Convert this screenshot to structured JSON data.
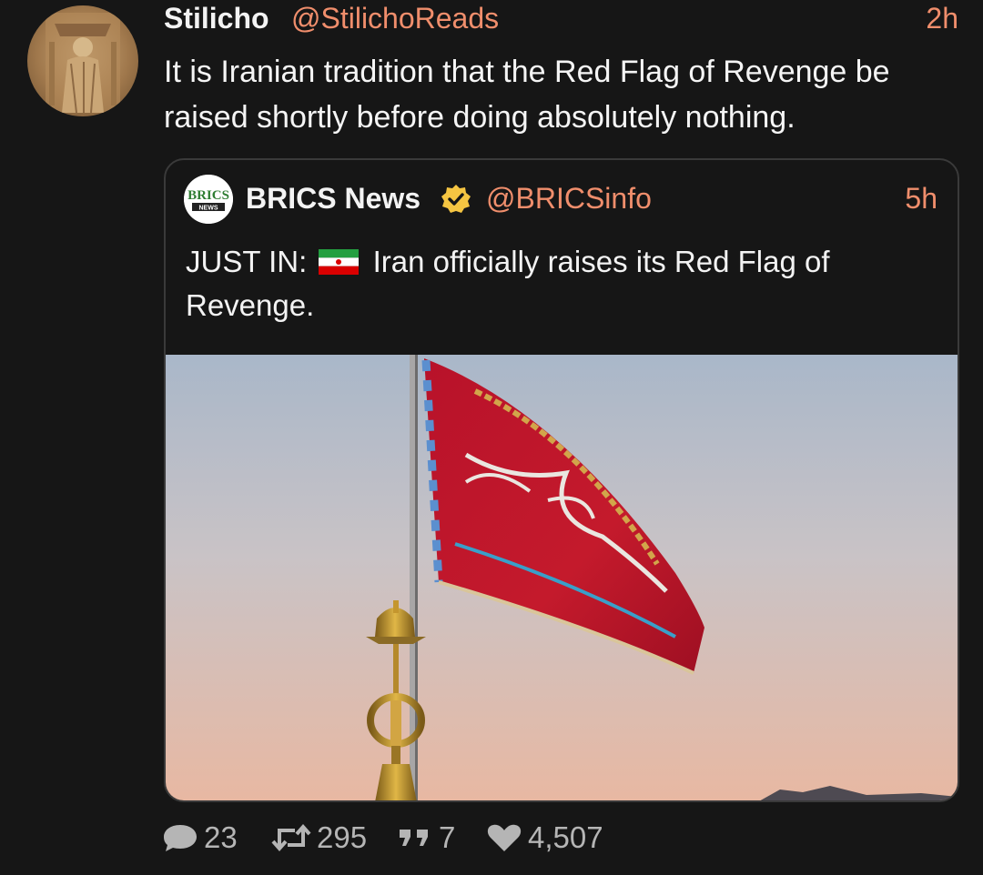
{
  "tweet": {
    "author_name": "Stilicho",
    "author_handle": "@StilichoReads",
    "time": "2h",
    "text": "It is Iranian tradition that the Red Flag of Revenge be raised shortly before doing absolutely nothing."
  },
  "quoted_tweet": {
    "avatar_text": "BRICS",
    "avatar_subtext": "NEWS",
    "author_name": "BRICS News",
    "author_handle": "@BRICSinfo",
    "time": "5h",
    "text_prefix": "JUST IN:",
    "flag_icon": "iran-flag-icon",
    "text_suffix": "Iran officially raises its Red Flag of Revenge."
  },
  "actions": {
    "replies": "23",
    "retweets": "295",
    "quotes": "7",
    "likes": "4,507"
  },
  "colors": {
    "background": "#161616",
    "accent": "#f08e6c",
    "text": "#f3f3f3",
    "muted": "#b5b5b5",
    "verified": "#f5c542"
  }
}
